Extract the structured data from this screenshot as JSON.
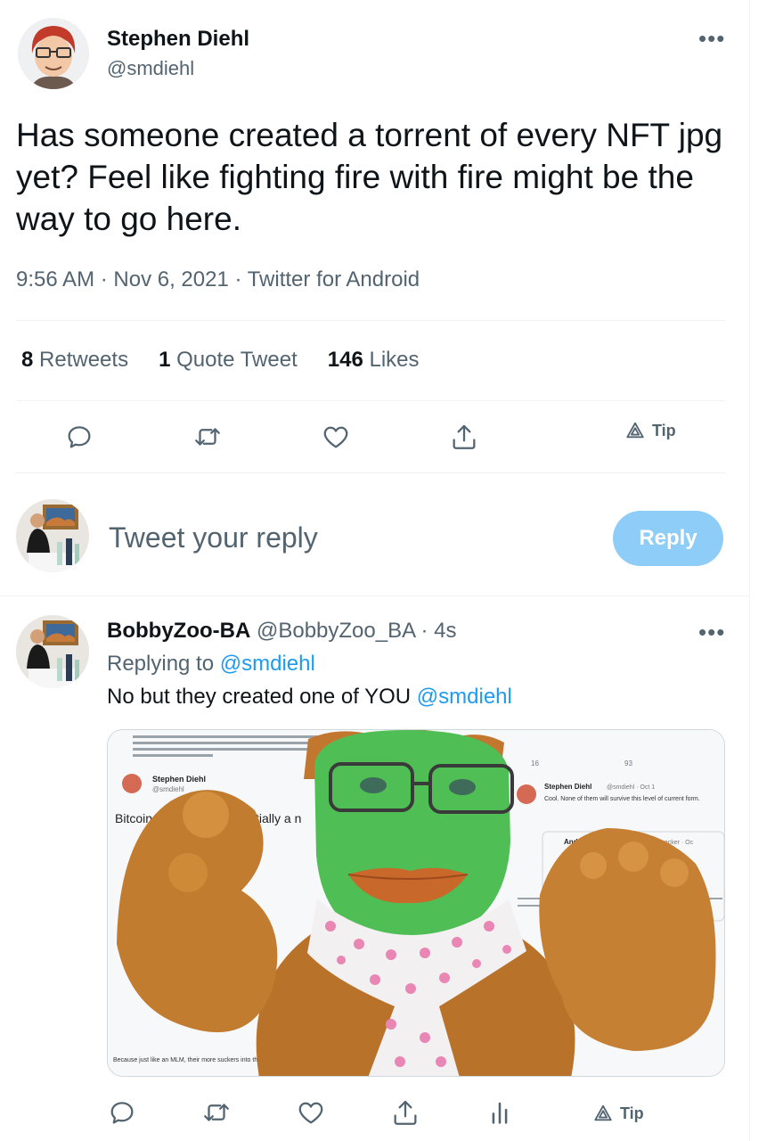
{
  "tweet": {
    "author_name": "Stephen Diehl",
    "author_handle": "@smdiehl",
    "text": "Has someone created a torrent of every NFT jpg yet? Feel like fighting fire with fire might be the way to go here.",
    "time": "9:56 AM",
    "date": "Nov 6, 2021",
    "source": "Twitter for Android",
    "retweets_count": "8",
    "retweets_label": "Retweets",
    "quotes_count": "1",
    "quotes_label": "Quote Tweet",
    "likes_count": "146",
    "likes_label": "Likes",
    "tip_label": "Tip"
  },
  "compose": {
    "placeholder": "Tweet your reply",
    "button_label": "Reply"
  },
  "reply": {
    "author_name": "BobbyZoo-BA",
    "author_handle": "@BobbyZoo_BA",
    "time_ago": "4s",
    "replying_prefix": "Replying to",
    "replying_to": "@smdiehl",
    "text": "No but they created one of YOU",
    "mention": "@smdiehl",
    "tip_label": "Tip"
  },
  "media": {
    "bg_author": "Stephen Diehl",
    "bg_handle": "@smdiehl",
    "bg_text_1": "Bitcoin is",
    "bg_text_2": "tially a n",
    "bg_right_author": "Stephen Diehl",
    "bg_right_meta": "@smdiehl · Oct 1",
    "bg_right_text": "Cool. None of them will survive this level of current form.",
    "bg_right_author2": "Andrew Ackerman",
    "bg_right_handle2": "@amacker · Oc",
    "bg_bottom_text": "Because just like an MLM, their more suckers into the sche",
    "bg_retweets": "16",
    "bg_likes": "93"
  },
  "colors": {
    "accent": "#1d9bf0",
    "reply_button": "#8ecdf8",
    "muted_text": "#536471",
    "divider": "#eff3f4"
  },
  "icons": [
    "more-icon",
    "reply-icon",
    "retweet-icon",
    "like-icon",
    "share-icon",
    "tip-icon",
    "analytics-icon"
  ]
}
